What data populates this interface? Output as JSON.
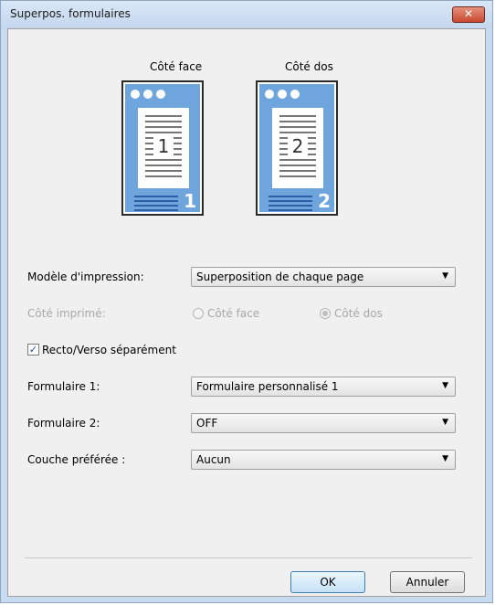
{
  "dialog": {
    "title": "Superpos. formulaires",
    "close_symbol": "✕"
  },
  "preview": {
    "front": {
      "label": "Côté face",
      "number": "1"
    },
    "back": {
      "label": "Côté dos",
      "number": "2"
    }
  },
  "fields": {
    "print_model": {
      "label": "Modèle d'impression:",
      "value": "Superposition de chaque page"
    },
    "printed_side": {
      "label": "Côté imprimé:",
      "option_front": "Côté face",
      "option_back": "Côté dos",
      "selected": "Côté dos"
    },
    "duplex": {
      "label": "Recto/Verso séparément",
      "checked": true
    },
    "form1": {
      "label": "Formulaire 1:",
      "value": "Formulaire personnalisé 1"
    },
    "form2": {
      "label": "Formulaire 2:",
      "value": "OFF"
    },
    "layer": {
      "label": "Couche préférée :",
      "value": "Aucun"
    }
  },
  "buttons": {
    "ok": "OK",
    "cancel": "Annuler"
  },
  "icons": {
    "dropdown": "chevron-down-icon",
    "check": "✓",
    "arrow": "▼"
  }
}
